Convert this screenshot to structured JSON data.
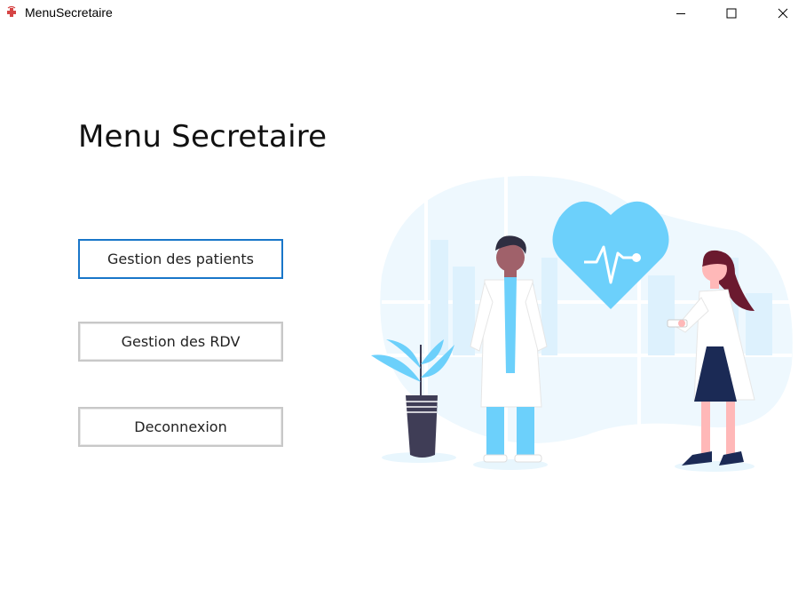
{
  "window": {
    "title": "MenuSecretaire",
    "controls": {
      "minimize": "minimize-icon",
      "maximize": "maximize-icon",
      "close": "close-icon"
    }
  },
  "main": {
    "heading": "Menu Secretaire",
    "buttons": {
      "patients": "Gestion des patients",
      "rdv": "Gestion des RDV",
      "logout": "Deconnexion"
    }
  },
  "colors": {
    "accent": "#1976c9",
    "illustration_blue": "#6cd0fb",
    "illustration_light": "#eef8fe"
  }
}
